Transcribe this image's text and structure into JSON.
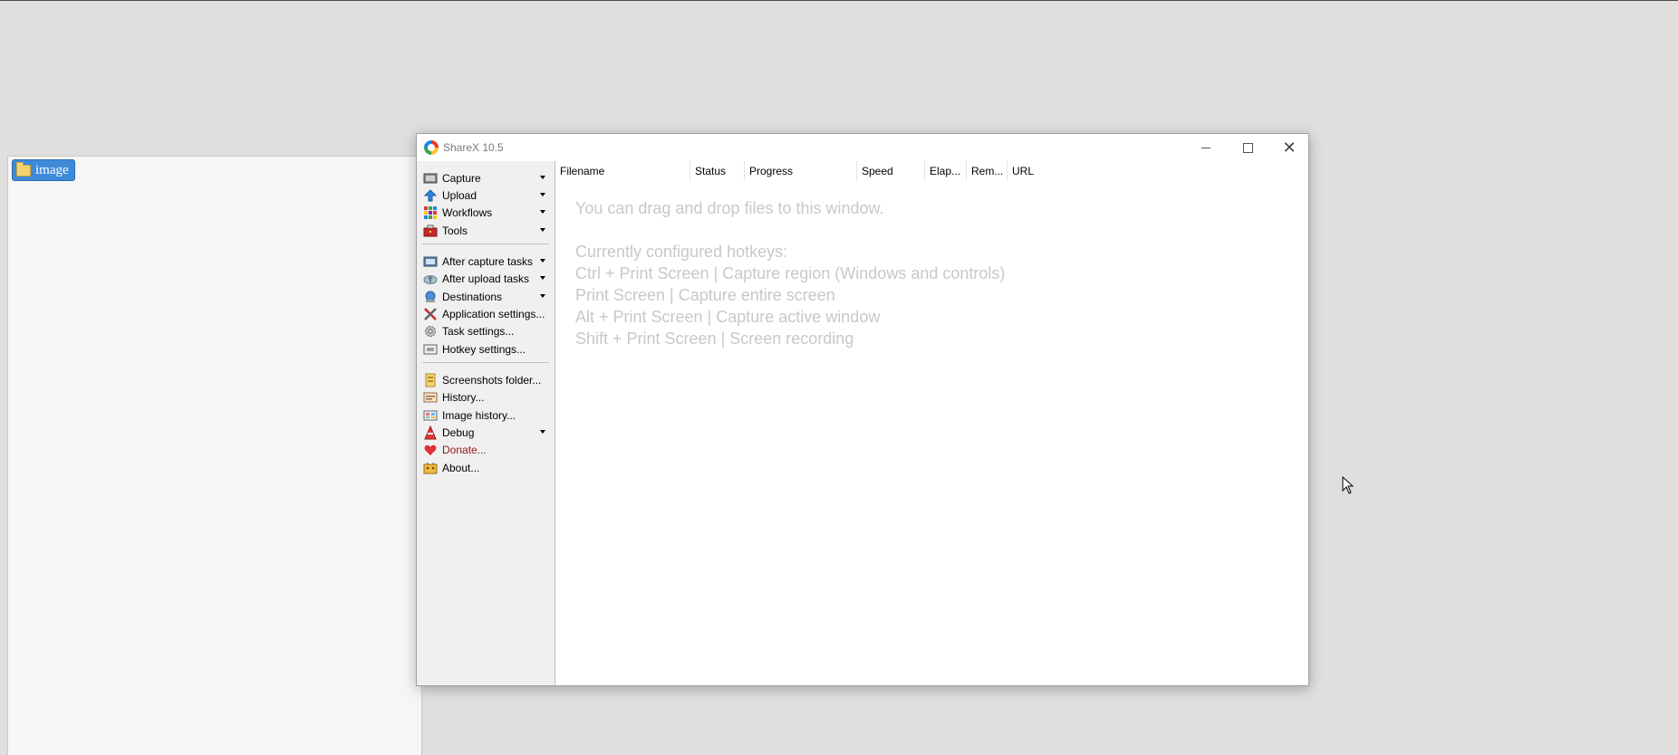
{
  "background_window": {
    "folder_label": "image"
  },
  "window": {
    "title": "ShareX 10.5",
    "controls": {
      "minimize": "–",
      "maximize": "☐",
      "close": "✕"
    }
  },
  "sidebar": {
    "items": [
      {
        "label": "Capture",
        "icon": "capture-icon",
        "has_dropdown": true
      },
      {
        "label": "Upload",
        "icon": "upload-icon",
        "has_dropdown": true
      },
      {
        "label": "Workflows",
        "icon": "workflows-icon",
        "has_dropdown": true
      },
      {
        "label": "Tools",
        "icon": "toolbox-icon",
        "has_dropdown": true
      },
      {
        "label": "After capture tasks",
        "icon": "after-capture-icon",
        "has_dropdown": true
      },
      {
        "label": "After upload tasks",
        "icon": "after-upload-icon",
        "has_dropdown": true
      },
      {
        "label": "Destinations",
        "icon": "destinations-icon",
        "has_dropdown": true
      },
      {
        "label": "Application settings...",
        "icon": "application-settings-icon",
        "has_dropdown": false
      },
      {
        "label": "Task settings...",
        "icon": "task-settings-icon",
        "has_dropdown": false
      },
      {
        "label": "Hotkey settings...",
        "icon": "hotkey-settings-icon",
        "has_dropdown": false
      },
      {
        "label": "Screenshots folder...",
        "icon": "screenshots-folder-icon",
        "has_dropdown": false
      },
      {
        "label": "History...",
        "icon": "history-icon",
        "has_dropdown": false
      },
      {
        "label": "Image history...",
        "icon": "image-history-icon",
        "has_dropdown": false
      },
      {
        "label": "Debug",
        "icon": "debug-icon",
        "has_dropdown": true
      },
      {
        "label": "Donate...",
        "icon": "heart-icon",
        "has_dropdown": false,
        "color": "#8b1a1a"
      },
      {
        "label": "About...",
        "icon": "about-icon",
        "has_dropdown": false
      }
    ]
  },
  "table": {
    "columns": [
      "Filename",
      "Status",
      "Progress",
      "Speed",
      "Elap...",
      "Rem...",
      "URL"
    ]
  },
  "hints": {
    "drag_drop": "You can drag and drop files to this window.",
    "hotkeys_title": "Currently configured hotkeys:",
    "hotkeys": [
      "Ctrl + Print Screen  |  Capture region (Windows and controls)",
      "Print Screen  |  Capture entire screen",
      "Alt + Print Screen  |  Capture active window",
      "Shift + Print Screen  |  Screen recording"
    ]
  }
}
